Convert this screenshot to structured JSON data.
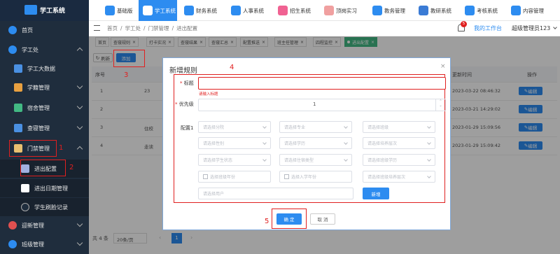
{
  "app": {
    "title": "学工系统"
  },
  "topnav": [
    {
      "label": "基础版",
      "color": "#2d8cf0"
    },
    {
      "label": "学工系统",
      "color": "#3a7bd5"
    },
    {
      "label": "财务系统",
      "color": "#2d8cf0"
    },
    {
      "label": "人事系统",
      "color": "#2d8cf0"
    },
    {
      "label": "招生系统",
      "color": "#f06292"
    },
    {
      "label": "顶岗实习",
      "color": "#f0a0a0"
    },
    {
      "label": "教务管理",
      "color": "#2d8cf0"
    },
    {
      "label": "教研系统",
      "color": "#3a7bd5"
    },
    {
      "label": "考核系统",
      "color": "#2d8cf0"
    },
    {
      "label": "内容管理",
      "color": "#2d8cf0"
    }
  ],
  "sidebar": {
    "items": [
      {
        "label": "首页"
      },
      {
        "label": "学工处"
      },
      {
        "label": "学工大数据"
      },
      {
        "label": "学籍管理"
      },
      {
        "label": "宿舍管理"
      },
      {
        "label": "查寝管理"
      },
      {
        "label": "门禁管理"
      },
      {
        "label": "进出配置"
      },
      {
        "label": "进出日期管理"
      },
      {
        "label": "学生刷脸记录"
      },
      {
        "label": "迎新管理"
      },
      {
        "label": "班级管理"
      }
    ]
  },
  "header": {
    "breadcrumb": [
      "首页",
      "学工处",
      "门禁管理",
      "进出配置"
    ],
    "notification_count": "5",
    "workbench": "我的工作台",
    "user": "超级管理员123"
  },
  "tags": [
    "首页",
    "查寝规则",
    "打卡实况",
    "查寝结果",
    "查寝汇总",
    "配置推送",
    "班主任管理",
    "四程监控",
    "进出配置"
  ],
  "toolbar": {
    "refresh": "刷新",
    "add": "添加"
  },
  "table": {
    "headers": {
      "index": "序号",
      "time": "更新时间",
      "action": "操作"
    },
    "rows": [
      {
        "index": "1",
        "mid": "23",
        "time": "2023-03-22 08:46:32",
        "action": "编辑"
      },
      {
        "index": "2",
        "mid": "",
        "time": "2023-03-21 14:29:02",
        "action": "编辑"
      },
      {
        "index": "3",
        "mid": "住校",
        "time": "2023-01-29 15:09:56",
        "action": "编辑"
      },
      {
        "index": "4",
        "mid": "走读",
        "time": "2023-01-29 15:09:42",
        "action": "编辑"
      }
    ]
  },
  "modal": {
    "title": "新增规则",
    "title_label": "标题",
    "title_error": "请输入标题",
    "priority_label": "优先级",
    "priority_value": "1",
    "config_label": "配置1",
    "selects": [
      [
        "请选择分院",
        "请选择专业",
        "请选择班级"
      ],
      [
        "请选择性别",
        "请选择学历",
        "请选择培养层次"
      ],
      [
        "请选择学生状态",
        "请选择住宿类型",
        "请选择班级学历"
      ],
      [
        "选择班级年份",
        "选择入学年份",
        "请选择班级培养层次"
      ]
    ],
    "user_select": "请选择用户",
    "add_button": "新增",
    "confirm": "确 定",
    "cancel": "取 消"
  },
  "annotations": {
    "a1": "1",
    "a2": "2",
    "a3": "3",
    "a4": "4",
    "a5": "5"
  },
  "footer": {
    "total": "共 4 条",
    "page_size": "20条/页",
    "page": "1"
  }
}
